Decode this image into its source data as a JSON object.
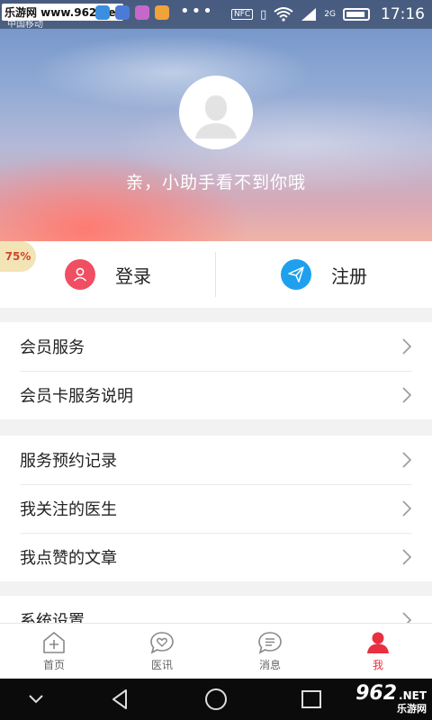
{
  "status_bar": {
    "watermark": "乐游网 www.962.net",
    "carrier": "中国移动",
    "signal_label": "2G",
    "time": "17:16",
    "nfc_label": "NFC"
  },
  "profile": {
    "greeting": "亲，小助手看不到你哦",
    "badge_percent": "75%"
  },
  "auth": {
    "login_label": "登录",
    "register_label": "注册"
  },
  "menu_groups": [
    {
      "items": [
        {
          "label": "会员服务"
        },
        {
          "label": "会员卡服务说明"
        }
      ]
    },
    {
      "items": [
        {
          "label": "服务预约记录"
        },
        {
          "label": "我关注的医生"
        },
        {
          "label": "我点赞的文章"
        }
      ]
    },
    {
      "items": [
        {
          "label": "系统设置"
        }
      ]
    }
  ],
  "bottom_nav": [
    {
      "label": "首页",
      "icon": "home-icon"
    },
    {
      "label": "医讯",
      "icon": "heart-chat-icon"
    },
    {
      "label": "消息",
      "icon": "message-icon"
    },
    {
      "label": "我",
      "icon": "profile-icon",
      "active": true
    }
  ],
  "colors": {
    "accent_red": "#e8303f",
    "login_icon_bg": "#f04e62",
    "register_icon_bg": "#1ea0ef"
  },
  "footer_watermark": {
    "number": "962",
    "suffix": ".NET",
    "sub": "乐游网"
  }
}
